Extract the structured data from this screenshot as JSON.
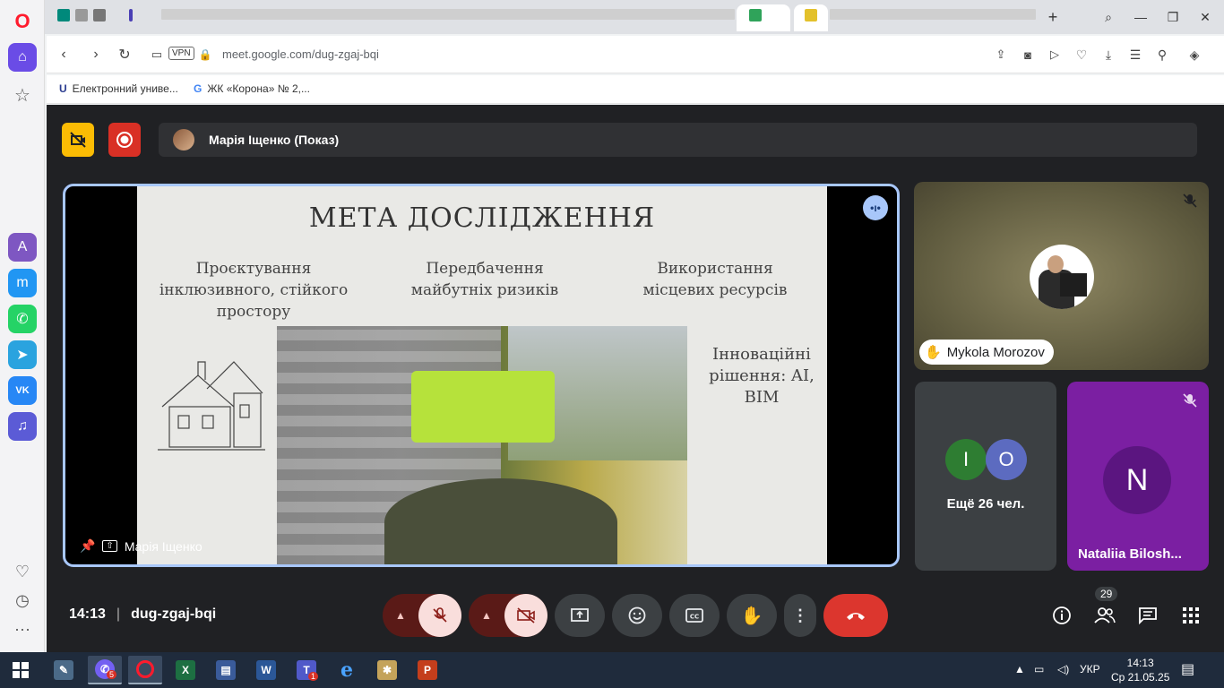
{
  "browser": {
    "url": "meet.google.com/dug-zgaj-bqi",
    "vpn_label": "VPN",
    "bookmarks": [
      {
        "label": "Електронний униве...",
        "icon": "university-icon"
      },
      {
        "label": "ЖК «Корона» № 2,...",
        "icon": "google-icon"
      }
    ]
  },
  "meet": {
    "presenter_bar_text": "Марія Іщенко (Показ)",
    "share_owner": "Марія Іщенко",
    "slide": {
      "title": "МЕТА ДОСЛІДЖЕННЯ",
      "col1": "Проєктування інклюзивного, стійкого простору",
      "col2": "Передбачення майбутніх ризиків",
      "col3": "Використання місцевих ресурсів",
      "side_text": "Інноваційні рішення: AI, BIM"
    },
    "participants": {
      "mykola": "Mykola Morozov",
      "bubbles": [
        "I",
        "O"
      ],
      "more": "Ещё 26 чел.",
      "natalia_initial": "N",
      "natalia": "Nataliia Bilosh..."
    },
    "time": "14:13",
    "meeting_code": "dug-zgaj-bqi",
    "people_count": "29"
  },
  "taskbar": {
    "language": "УКР",
    "clock_time": "14:13",
    "clock_date": "Ср 21.05.25",
    "viber_badge": "5",
    "teams_badge": "1"
  },
  "colors": {
    "share_border": "#a8c7fa",
    "end_call": "#dc362e",
    "natalia_tile": "#7b1fa2",
    "bubble_i": "#2e7d32",
    "bubble_o": "#5c6bc0"
  }
}
